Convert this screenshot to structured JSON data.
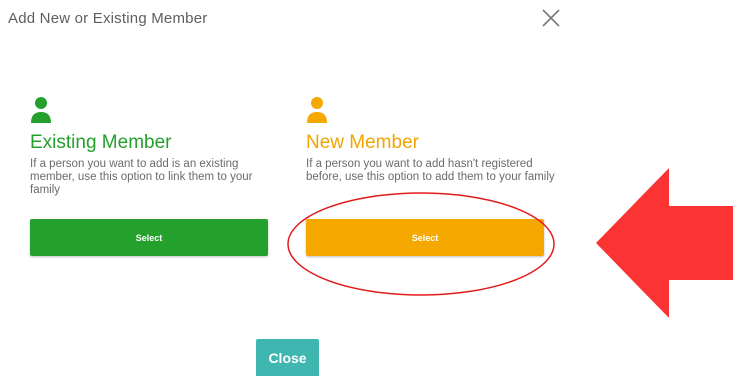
{
  "dialog": {
    "title": "Add New or Existing Member",
    "close_icon": "close-x-icon"
  },
  "options": {
    "existing": {
      "icon": "person-icon",
      "title": "Existing Member",
      "description": "If a person you want to add is an existing member, use this option to link them to your family",
      "button_label": "Select",
      "color": "#23a12c"
    },
    "new": {
      "icon": "person-icon",
      "title": "New Member",
      "description": "If a person you want to add hasn't registered before, use this option to add them to your family",
      "button_label": "Select",
      "color": "#f4a800"
    }
  },
  "annotations": {
    "highlight_color": "#e11b1b",
    "arrow_color": "#fb3333"
  },
  "footer": {
    "close_label": "Close",
    "close_color": "#3fb6b0"
  }
}
